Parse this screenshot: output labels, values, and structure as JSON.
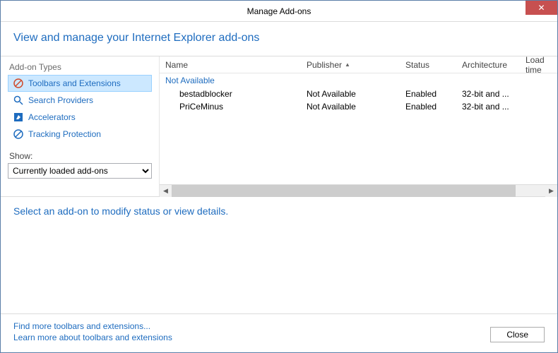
{
  "titlebar": {
    "title": "Manage Add-ons"
  },
  "header": {
    "text": "View and manage your Internet Explorer add-ons"
  },
  "sidebar": {
    "types_heading": "Add-on Types",
    "items": [
      {
        "label": "Toolbars and Extensions"
      },
      {
        "label": "Search Providers"
      },
      {
        "label": "Accelerators"
      },
      {
        "label": "Tracking Protection"
      }
    ],
    "show_label": "Show:",
    "show_selected": "Currently loaded add-ons"
  },
  "table": {
    "columns": {
      "name": "Name",
      "publisher": "Publisher",
      "status": "Status",
      "architecture": "Architecture",
      "load_time": "Load time"
    },
    "group": "Not Available",
    "rows": [
      {
        "name": "bestadblocker",
        "publisher": "Not Available",
        "status": "Enabled",
        "architecture": "32-bit and ..."
      },
      {
        "name": "PriCeMinus",
        "publisher": "Not Available",
        "status": "Enabled",
        "architecture": "32-bit and ..."
      }
    ]
  },
  "detail": {
    "prompt": "Select an add-on to modify status or view details."
  },
  "footer": {
    "find_link": "Find more toolbars and extensions...",
    "learn_link": "Learn more about toolbars and extensions",
    "close": "Close"
  }
}
